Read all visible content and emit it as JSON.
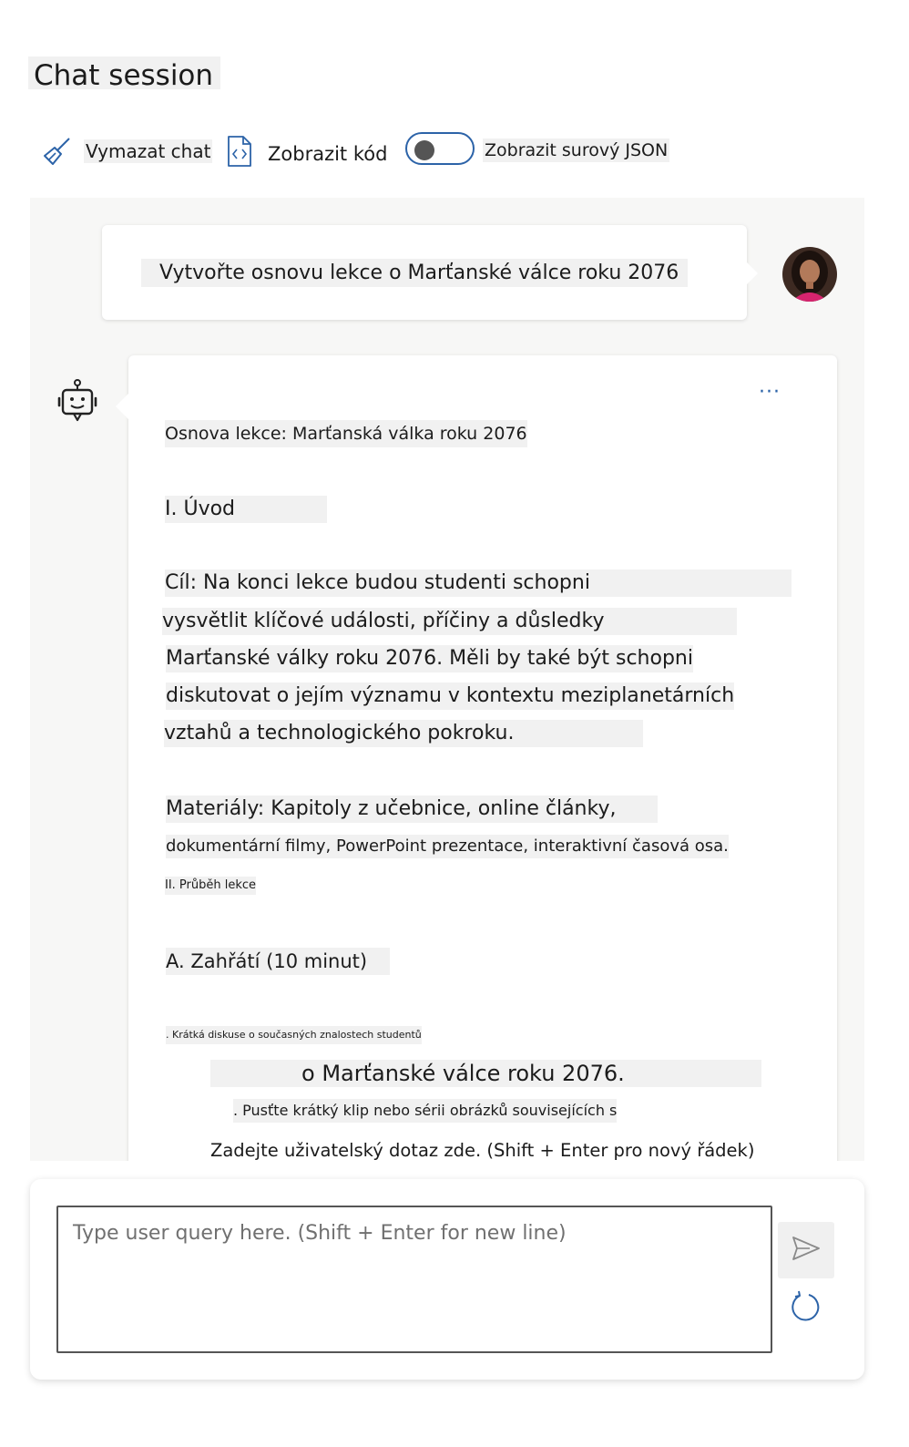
{
  "header": {
    "title": "Chat session"
  },
  "toolbar": {
    "clear_label": "Vymazat chat",
    "view_code_label": "Zobrazit kód",
    "raw_json_label": "Zobrazit surový JSON",
    "raw_json_enabled": false
  },
  "chat": {
    "user_message": "Vytvořte osnovu lekce o Marťanské válce roku 2076",
    "bot_lines": [
      "Osnova lekce: Marťanská válka roku 2076",
      "I. Úvod",
      "Cíl: Na konci lekce budou studenti schopni",
      "vysvětlit klíčové události, příčiny a důsledky",
      "Marťanské války roku 2076. Měli by také být schopni",
      "diskutovat o jejím významu v kontextu meziplanetárních",
      "vztahů a technologického pokroku.",
      "Materiály: Kapitoly z učebnice, online články,",
      "dokumentární filmy, PowerPoint prezentace, interaktivní časová osa.",
      "II. Průběh lekce",
      "A. Zahřátí (10 minut)",
      ". Krátká diskuse o současných znalostech studentů",
      "o Marťanské válce roku 2076.",
      ". Pusťte krátký klip nebo sérii obrázků souvisejících s",
      "Zadejte uživatelský dotaz zde. (Shift + Enter pro nový řádek)"
    ]
  },
  "input": {
    "placeholder": "Type user query here. (Shift + Enter for new line)"
  },
  "colors": {
    "accent": "#2c63a8",
    "chat_bg": "#f7f7f6"
  },
  "icons": [
    "broom-icon",
    "code-file-icon",
    "toggle-icon",
    "avatar",
    "bot-icon",
    "more-icon",
    "send-icon",
    "refresh-icon"
  ]
}
